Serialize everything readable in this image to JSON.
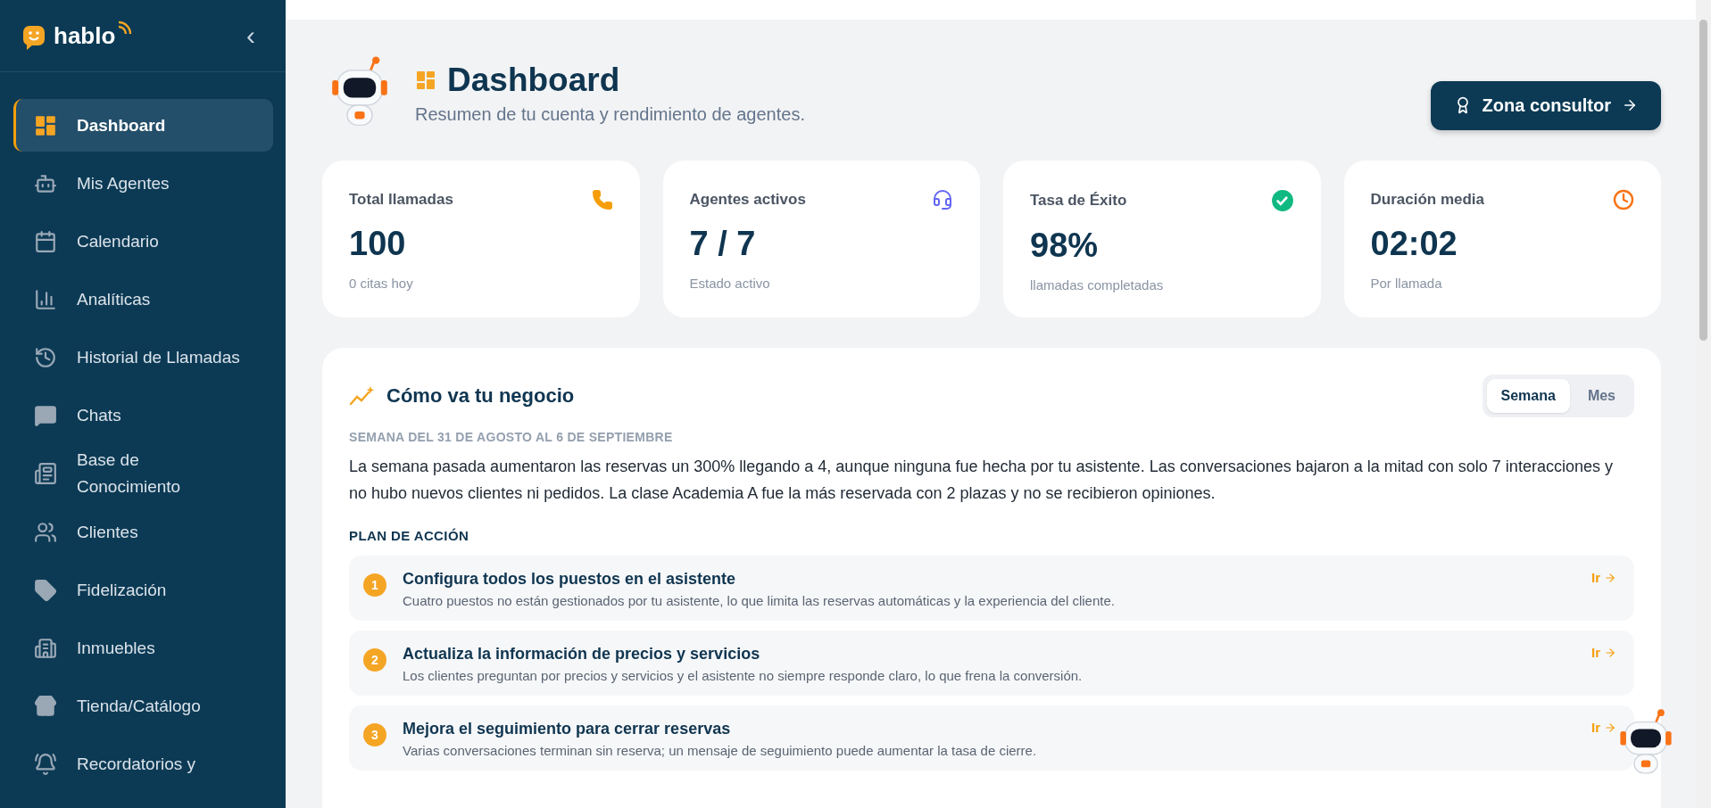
{
  "sidebar": {
    "logo": "hablo",
    "collapse_icon": "‹",
    "items": [
      {
        "label": "Dashboard",
        "selected": true
      },
      {
        "label": "Mis Agentes",
        "selected": false
      },
      {
        "label": "Calendario",
        "selected": false
      },
      {
        "label": "Analíticas",
        "selected": false
      },
      {
        "label": "Historial de Llamadas",
        "selected": false
      },
      {
        "label": "Chats",
        "selected": false
      },
      {
        "label": "Base de\nConocimiento",
        "selected": false
      },
      {
        "label": "Clientes",
        "selected": false
      },
      {
        "label": "Fidelización",
        "selected": false
      },
      {
        "label": "Inmuebles",
        "selected": false
      },
      {
        "label": "Tienda/Catálogo",
        "selected": false
      },
      {
        "label": "Recordatorios y",
        "selected": false
      }
    ]
  },
  "header": {
    "title": "Dashboard",
    "subtitle": "Resumen de tu cuenta y rendimiento de agentes.",
    "button": "Zona consultor"
  },
  "stats": [
    {
      "label": "Total llamadas",
      "value": "100",
      "note": "0 citas hoy",
      "color": "#f59e0b"
    },
    {
      "label": "Agentes activos",
      "value": "7 / 7",
      "note": "Estado activo",
      "color": "#6366f1"
    },
    {
      "label": "Tasa de Éxito",
      "value": "98%",
      "note": "llamadas completadas",
      "color": "#10b981"
    },
    {
      "label": "Duración media",
      "value": "02:02",
      "note": "Por llamada",
      "color": "#f97316"
    }
  ],
  "business": {
    "title": "Cómo va tu negocio",
    "tabs": [
      {
        "label": "Semana",
        "selected": true
      },
      {
        "label": "Mes",
        "selected": false
      }
    ],
    "period": "SEMANA DEL 31 DE AGOSTO AL 6 DE SEPTIEMBRE",
    "summary": "La semana pasada aumentaron las reservas un 300% llegando a 4, aunque ninguna fue hecha por tu asistente. Las conversaciones bajaron a la mitad con solo 7 interacciones y no hubo nuevos clientes ni pedidos. La clase Academia A fue la más reservada con 2 plazas y no se recibieron opiniones.",
    "plan_title": "PLAN DE ACCIÓN",
    "actions": [
      {
        "number": "1",
        "title": "Configura todos los puestos en el asistente",
        "text": "Cuatro puestos no están gestionados por tu asistente, lo que limita las reservas automáticas y la experiencia del cliente.",
        "link": "Ir"
      },
      {
        "number": "2",
        "title": "Actualiza la información de precios y servicios",
        "text": "Los clientes preguntan por precios y servicios y el asistente no siempre responde claro, lo que frena la conversión.",
        "link": "Ir"
      },
      {
        "number": "3",
        "title": "Mejora el seguimiento para cerrar reservas",
        "text": "Varias conversaciones terminan sin reserva; un mensaje de seguimiento puede aumentar la tasa de cierre.",
        "link": "Ir"
      }
    ]
  }
}
